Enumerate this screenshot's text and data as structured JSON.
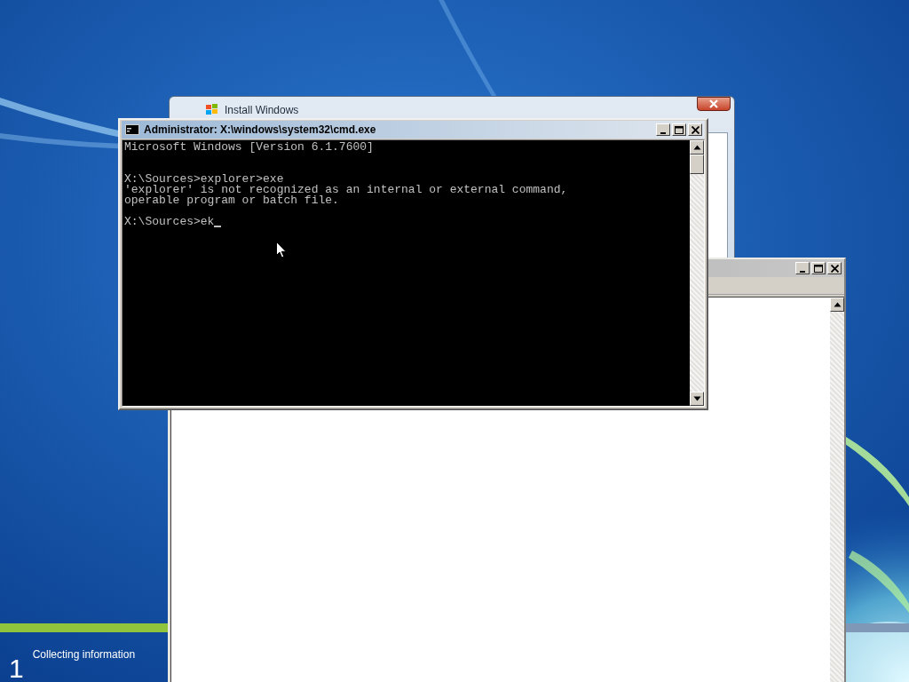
{
  "setup_progress": {
    "step_number": "1",
    "step_label": "Collecting information"
  },
  "windows": [
    {
      "kind": "setup",
      "title": "Install Windows"
    },
    {
      "kind": "blank",
      "active": false
    },
    {
      "kind": "console",
      "title": "Administrator: X:\\windows\\system32\\cmd.exe",
      "active": true,
      "lines": [
        {
          "kind": "text",
          "text": "Microsoft Windows [Version 6.1.7600]"
        },
        {
          "kind": "blank"
        },
        {
          "kind": "blank"
        },
        {
          "kind": "text",
          "text": "X:\\Sources>explorer>exe"
        },
        {
          "kind": "text",
          "text": "'explorer' is not recognized as an internal or external command,"
        },
        {
          "kind": "text",
          "text": "operable program or batch file."
        },
        {
          "kind": "blank"
        },
        {
          "kind": "prompt",
          "text": "X:\\Sources>ek"
        }
      ]
    }
  ]
}
